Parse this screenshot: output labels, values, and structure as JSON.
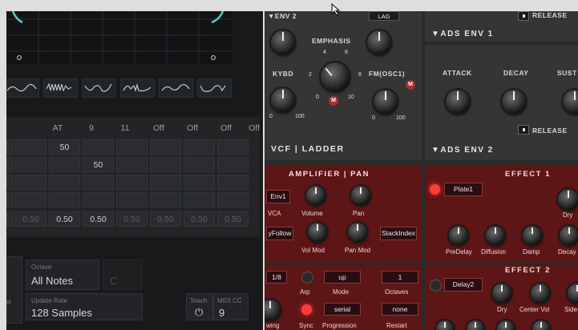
{
  "mod": {
    "seq_headers": [
      "AT",
      "9",
      "11",
      "Off",
      "Off",
      "Off",
      "Off"
    ],
    "seq_row1": [
      "",
      "50",
      "",
      "",
      "",
      "",
      ""
    ],
    "seq_row2": [
      "",
      "",
      "50",
      "",
      "",
      "",
      ""
    ],
    "seq_row_vals": [
      "0.50",
      "0.50",
      "0.50",
      "0.50",
      "0.50",
      "0.50",
      "0.50"
    ],
    "octave_label": "Octave",
    "octave_value": "All Notes",
    "note_value": "C",
    "update_label": "Update Rate",
    "update_value": "128 Samples",
    "teach_label": "Teach",
    "midicc_label": "MIDI CC",
    "midicc_value": "9",
    "partial_label": "el"
  },
  "synth": {
    "env2_label": "ENV 2",
    "lag_label": "LAG",
    "emphasis_label": "EMPHASIS",
    "kybd_label": "KYBD",
    "fm_label": "FM(OSC1)",
    "vcf_title": "VCF | LADDER",
    "release_label": "RELEASE",
    "ads_env1_title": "ADS ENV 1",
    "attack_label": "ATTACK",
    "decay_label": "DECAY",
    "sustain_label": "SUST",
    "ads_env2_title": "ADS ENV 2",
    "amp_title": "AMPLIFIER | PAN",
    "env1_box": "Env1",
    "vca_label": "VCA",
    "volume_label": "Volume",
    "pan_label": "Pan",
    "keyfollow_box": "yFollow",
    "volmod_label": "Vol Mod",
    "panmod_label": "Pan Mod",
    "stackindex_box": "StackIndex",
    "rate_box": "1/8",
    "arp_label": "Arp",
    "mode_box": "up",
    "mode_label": "Mode",
    "octaves_box": "1",
    "octaves_label": "Octaves",
    "swing_label": "wing",
    "sync_label": "Sync",
    "progression_box": "serial",
    "progression_label": "Progression",
    "restart_box": "none",
    "restart_label": "Restart",
    "effect1_title": "EFFECT 1",
    "plate_box": "Plate1",
    "dry_label": "Dry",
    "predelay_label": "PreDelay",
    "diffusion_label": "Diffusion",
    "damp_label": "Damp",
    "decay2_label": "Decay",
    "effect2_title": "EFFECT 2",
    "delay_box": "Delay2",
    "dry2_label": "Dry",
    "centervol_label": "Center Vol",
    "side_label": "Side",
    "emph_ticks": [
      "4",
      "6",
      "2",
      "8",
      "0",
      "10"
    ],
    "fm_ticks": [
      "0",
      "100"
    ],
    "kybd_ticks": [
      "0",
      "100"
    ]
  },
  "colors": {
    "accent_teal": "#4ecdc4",
    "led_red": "#ff3b3b",
    "panel_red": "#5e1516"
  }
}
